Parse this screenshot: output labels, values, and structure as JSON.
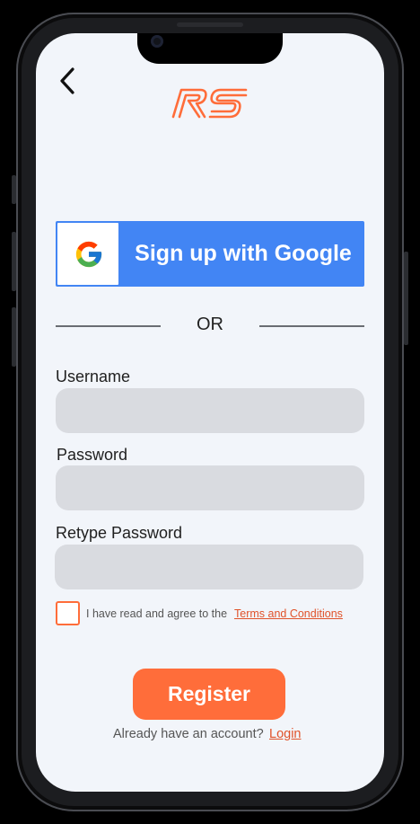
{
  "header": {
    "logo_text": "RS",
    "back_icon": "chevron-left-icon"
  },
  "google": {
    "label": "Sign up with Google",
    "icon": "google-g-icon"
  },
  "divider": {
    "text": "OR"
  },
  "form": {
    "username": {
      "label": "Username",
      "value": "",
      "placeholder": ""
    },
    "password": {
      "label": "Password",
      "value": "",
      "placeholder": ""
    },
    "retype_password": {
      "label": "Retype Password",
      "value": "",
      "placeholder": ""
    },
    "agree_text": "I have read and agree to the",
    "terms_link": "Terms and Conditions",
    "terms_checked": false
  },
  "actions": {
    "register_label": "Register",
    "already_text": "Already have an account?",
    "login_link": "Login"
  },
  "colors": {
    "accent": "#ff6d3a",
    "google_blue": "#4285f4",
    "field_bg": "#d9dbe0",
    "screen_bg": "#f2f5fa"
  }
}
